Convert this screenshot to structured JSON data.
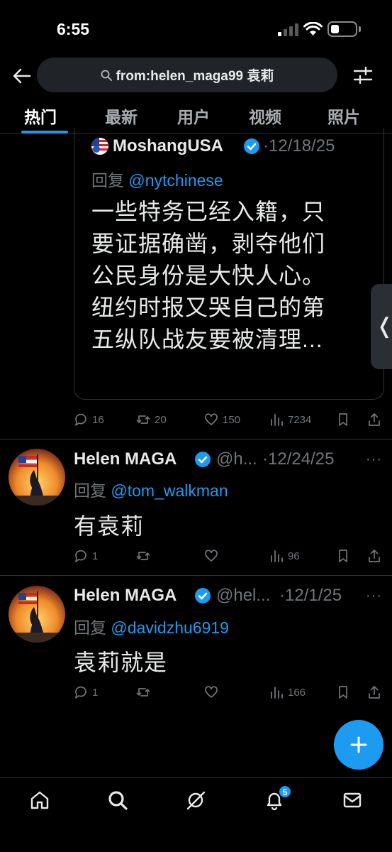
{
  "status_bar": {
    "time": "6:55"
  },
  "search": {
    "query": "from:helen_maga99 袁莉"
  },
  "tabs": [
    {
      "label": "热门",
      "active": true
    },
    {
      "label": "最新"
    },
    {
      "label": "用户"
    },
    {
      "label": "视频"
    },
    {
      "label": "照片"
    }
  ],
  "quote": {
    "author": "MoshangUSA",
    "date": "·12/18/25",
    "reply_prefix": "回复 ",
    "reply_handle": "@nytchinese",
    "text_lines": [
      "一些特务已经入籍，只",
      "要证据确凿，剥夺他们",
      "公民身份是大快人心。",
      "纽约时报又哭自己的第",
      "五纵队战友要被清理..."
    ]
  },
  "tweet0_actions": {
    "replies": "16",
    "retweets": "20",
    "likes": "150",
    "views": "7234"
  },
  "tweets": [
    {
      "name": "Helen MAGA",
      "handle": "@h...",
      "date": "·12/24/25",
      "reply_prefix": "回复 ",
      "reply_handle": "@tom_walkman",
      "text": "有袁莉",
      "replies": "1",
      "views": "96"
    },
    {
      "name": "Helen MAGA",
      "handle": "@hel...",
      "date": "·12/1/25",
      "reply_prefix": "回复 ",
      "reply_handle": "@davidzhu6919",
      "text": "袁莉就是",
      "replies": "1",
      "views": "166"
    }
  ],
  "more_label": "···",
  "side_handle_label": "❬",
  "nav": {
    "notification_badge": "5"
  },
  "colors": {
    "accent": "#1d9bf0",
    "muted": "#71767b",
    "background": "#000000"
  },
  "icons": [
    "back-arrow-icon",
    "search-icon",
    "filter-sliders-icon",
    "verified-badge-icon",
    "reply-icon",
    "retweet-icon",
    "like-icon",
    "views-icon",
    "bookmark-icon",
    "share-icon",
    "compose-plus-icon",
    "home-icon",
    "grok-icon",
    "bell-icon",
    "mail-icon"
  ]
}
